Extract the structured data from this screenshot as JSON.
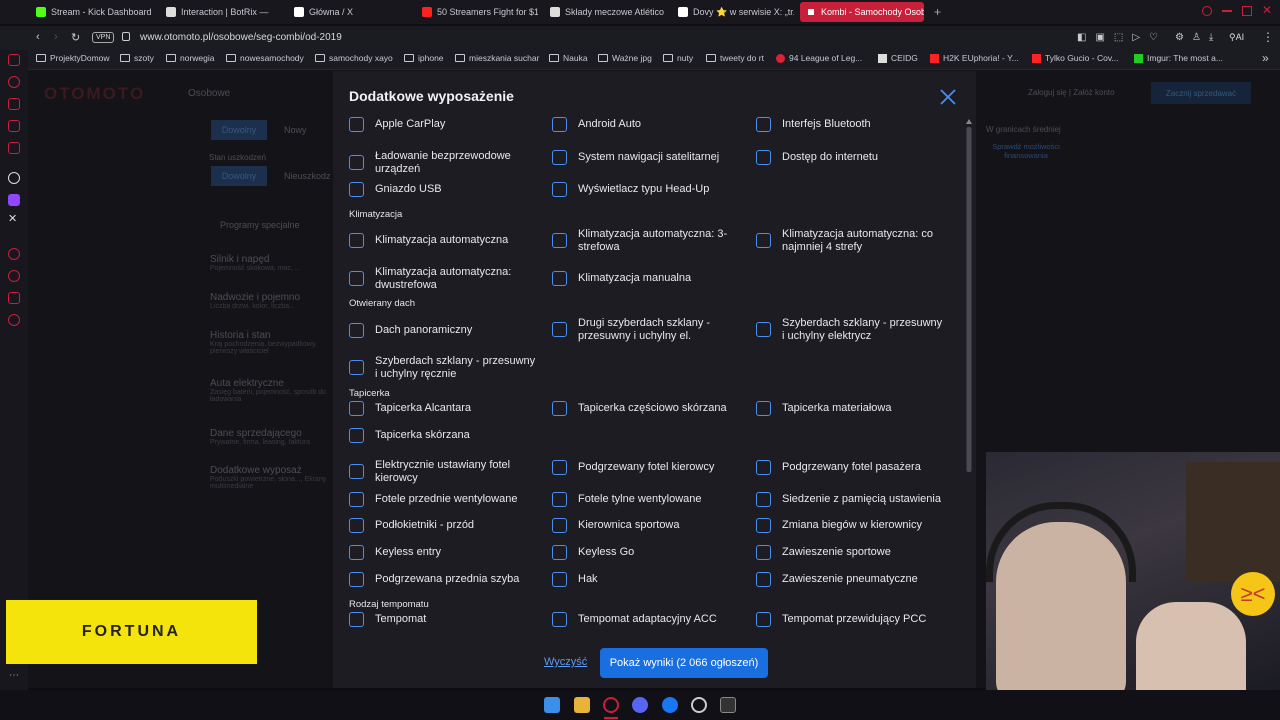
{
  "tabs": [
    {
      "label": "Stream - Kick Dashboard",
      "color": "#53fc18"
    },
    {
      "label": "Interaction | BotRix —",
      "color": "#ffffff"
    },
    {
      "label": "Główna / X",
      "color": "#ffffff"
    },
    {
      "label": "50 Streamers Fight for $1...",
      "color": "#ff2020"
    },
    {
      "label": "Składy meczowe Atlético ...",
      "color": "#ffffff"
    },
    {
      "label": "Dovy ⭐ w serwisie X: „tr...",
      "color": "#ffffff"
    },
    {
      "label": "Kombi - Samochody Osob...",
      "color": "#c8203a"
    }
  ],
  "address": {
    "vpn": "VPN",
    "url": "www.otomoto.pl/osobowe/seg-combi/od-2019"
  },
  "bookmarks": [
    "ProjektyDomow",
    "szoty",
    "norwegia",
    "nowesamochody",
    "samochody xayo",
    "iphone",
    "mieszkania suchar",
    "Nauka",
    "Ważne jpg",
    "nuty",
    "tweety do rt",
    "94 League of Leg...",
    "CEIDG",
    "H2K EUphoria! - Y...",
    "Tylko Gucio - Cov...",
    "Imgur: The most a..."
  ],
  "background_page": {
    "logo": "OTOMOTO",
    "category": "Osobowe",
    "tabs": [
      "Dowolny",
      "Nowy"
    ],
    "damage_label": "Stan uszkodzeń",
    "damage_tabs": [
      "Dowolny",
      "Nieuszkodz"
    ],
    "special_programs": "Programy specjalne",
    "filters": [
      {
        "title": "Silnik i napęd",
        "sub": "Pojemność skokowa, moc, ..."
      },
      {
        "title": "Nadwozie i pojemno",
        "sub": "Liczba drzwi, kolor, liczba..."
      },
      {
        "title": "Historia i stan",
        "sub": "Kraj pochodzenia, bezwypadkowy, pierwszy właściciel"
      },
      {
        "title": "Auta elektryczne",
        "sub": "Zasięg baterii, pojemność, sposób do ładowania"
      },
      {
        "title": "Dane sprzedającego",
        "sub": "Prywatne, firma, leasing, faktura"
      },
      {
        "title": "Dodatkowe wyposaż",
        "sub": "Poduszki powietrzne, słona..., Ekrany multimedialne"
      }
    ],
    "right": {
      "account": "Zaloguj się | Załóż konto",
      "sell": "Zacznij sprzedawać",
      "avg": "W granicach średniej",
      "finance": "Sprawdź możliwości finansowania"
    }
  },
  "modal": {
    "title": "Dodatkowe wyposażenie",
    "clear_label": "Wyczyść",
    "show_label": "Pokaż wyniki (2 066 ogłoszeń)",
    "sections": [
      {
        "heading": "",
        "items": [
          "Apple CarPlay",
          "Android Auto",
          "Interfejs Bluetooth",
          "Ładowanie bezprzewodowe urządzeń",
          "System nawigacji satelitarnej",
          "Dostęp do internetu",
          "Gniazdo USB",
          "Wyświetlacz typu Head-Up"
        ]
      },
      {
        "heading": "Klimatyzacja",
        "items": [
          "Klimatyzacja automatyczna",
          "Klimatyzacja automatyczna: 3-strefowa",
          "Klimatyzacja automatyczna: co najmniej 4 strefy",
          "Klimatyzacja automatyczna: dwustrefowa",
          "Klimatyzacja manualna"
        ]
      },
      {
        "heading": "Otwierany dach",
        "items": [
          "Dach panoramiczny",
          "Drugi szyberdach szklany - przesuwny i uchylny el.",
          "Szyberdach szklany - przesuwny i uchylny elektrycz",
          "Szyberdach szklany - przesuwny i uchylny ręcznie"
        ]
      },
      {
        "heading": "Tapicerka",
        "items": [
          "Tapicerka Alcantara",
          "Tapicerka częściowo skórzana",
          "Tapicerka materiałowa",
          "Tapicerka skórzana",
          "Elektrycznie ustawiany fotel kierowcy",
          "Podgrzewany fotel kierowcy",
          "Podgrzewany fotel pasażera",
          "Fotele przednie wentylowane",
          "Fotele tylne wentylowane",
          "Siedzenie z pamięcią ustawienia",
          "Podłokietniki - przód",
          "Kierownica sportowa",
          "Zmiana biegów w kierownicy",
          "Keyless entry",
          "Keyless Go",
          "Zawieszenie sportowe",
          "Podgrzewana przednia szyba",
          "Hak",
          "Zawieszenie pneumatyczne"
        ]
      },
      {
        "heading": "Rodzaj tempomatu",
        "items": [
          "Tempomat",
          "Tempomat adaptacyjny ACC",
          "Tempomat przewidujący PCC"
        ]
      }
    ]
  },
  "overlay": {
    "sponsor": "FORTUNA"
  },
  "colors": {
    "accent": "#1a6fe0",
    "checkbox": "#4a8ff0",
    "brand": "#c8203a"
  }
}
